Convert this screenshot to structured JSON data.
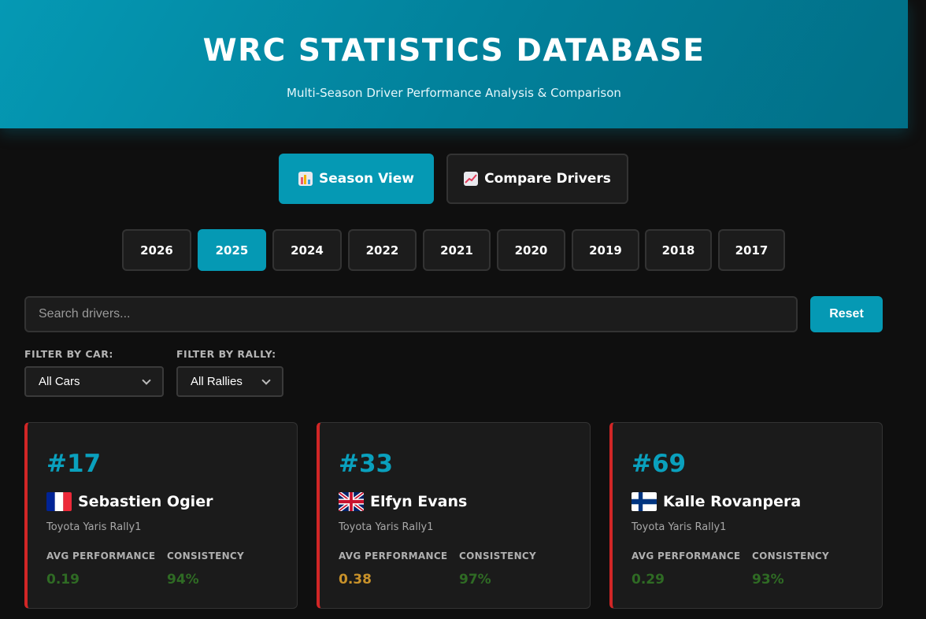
{
  "header": {
    "title": "WRC STATISTICS DATABASE",
    "subtitle": "Multi-Season Driver Performance Analysis & Comparison"
  },
  "views": {
    "season_label": "Season View",
    "compare_label": "Compare Drivers",
    "season_icon": "bar-chart-icon",
    "compare_icon": "trend-chart-icon"
  },
  "years": {
    "items": [
      "2026",
      "2025",
      "2024",
      "2022",
      "2021",
      "2020",
      "2019",
      "2018",
      "2017"
    ],
    "selected": "2025"
  },
  "search": {
    "placeholder": "Search drivers...",
    "value": "",
    "reset_label": "Reset"
  },
  "filters": {
    "car_label": "FILTER BY CAR:",
    "car_value": "All Cars",
    "rally_label": "FILTER BY RALLY:",
    "rally_value": "All Rallies"
  },
  "colors": {
    "accent": "#0599b4",
    "card_border": "#d12626",
    "good": "#2f6b24",
    "warn": "#c9922a"
  },
  "drivers": [
    {
      "number": "#17",
      "flag": "france-flag-icon",
      "name": "Sebastien Ogier",
      "car": "Toyota Yaris Rally1",
      "avg_label": "AVG PERFORMANCE",
      "avg": "0.19",
      "avg_color": "#2f6b24",
      "consistency_label": "CONSISTENCY",
      "consistency": "94%",
      "consistency_color": "#2f6b24"
    },
    {
      "number": "#33",
      "flag": "uk-flag-icon",
      "name": "Elfyn Evans",
      "car": "Toyota Yaris Rally1",
      "avg_label": "AVG PERFORMANCE",
      "avg": "0.38",
      "avg_color": "#c9922a",
      "consistency_label": "CONSISTENCY",
      "consistency": "97%",
      "consistency_color": "#2f6b24"
    },
    {
      "number": "#69",
      "flag": "finland-flag-icon",
      "name": "Kalle Rovanpera",
      "car": "Toyota Yaris Rally1",
      "avg_label": "AVG PERFORMANCE",
      "avg": "0.29",
      "avg_color": "#2f6b24",
      "consistency_label": "CONSISTENCY",
      "consistency": "93%",
      "consistency_color": "#2f6b24"
    }
  ]
}
